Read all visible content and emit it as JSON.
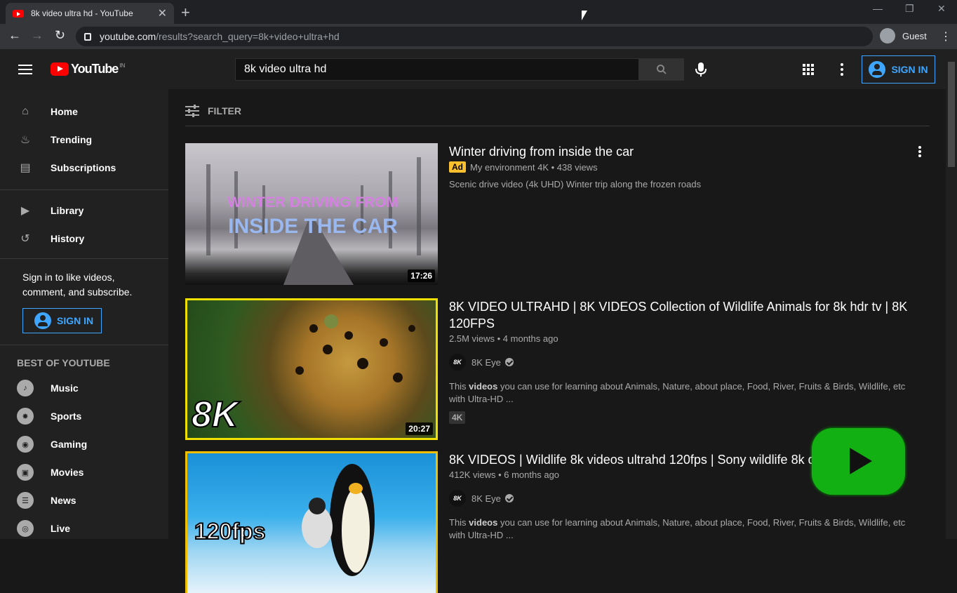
{
  "browser": {
    "tab_title": "8k video ultra hd - YouTube",
    "url_host": "youtube.com",
    "url_path": "/results?search_query=8k+video+ultra+hd",
    "profile": "Guest"
  },
  "header": {
    "logo_text": "YouTube",
    "country_code": "IN",
    "search_value": "8k video ultra hd",
    "sign_in": "SIGN IN"
  },
  "sidebar": {
    "items": [
      {
        "label": "Home",
        "icon": "home-icon"
      },
      {
        "label": "Trending",
        "icon": "flame-icon"
      },
      {
        "label": "Subscriptions",
        "icon": "subscriptions-icon"
      }
    ],
    "library_items": [
      {
        "label": "Library",
        "icon": "library-icon"
      },
      {
        "label": "History",
        "icon": "history-icon"
      }
    ],
    "signin_prompt": "Sign in to like videos, comment, and subscribe.",
    "signin_button": "SIGN IN",
    "best_heading": "BEST OF YOUTUBE",
    "best_items": [
      {
        "label": "Music",
        "icon": "music-icon"
      },
      {
        "label": "Sports",
        "icon": "sports-icon"
      },
      {
        "label": "Gaming",
        "icon": "gaming-icon"
      },
      {
        "label": "Movies",
        "icon": "movies-icon"
      },
      {
        "label": "News",
        "icon": "news-icon"
      },
      {
        "label": "Live",
        "icon": "live-icon"
      }
    ]
  },
  "main": {
    "filter_label": "FILTER",
    "results": [
      {
        "title": "Winter driving from inside the car",
        "ad_label": "Ad",
        "channel_meta": "My environment 4K • 438 views",
        "description": "Scenic drive video (4k UHD) Winter trip along the frozen roads",
        "duration": "17:26",
        "thumb_text_1": "WINTER DRIVING FROM",
        "thumb_text_2": "INSIDE THE CAR"
      },
      {
        "title": "8K VIDEO ULTRAHD | 8K VIDEOS Collection of Wildlife Animals for 8k hdr tv | 8K 120FPS",
        "meta": "2.5M views • 4 months ago",
        "channel": "8K Eye",
        "desc_pre": "This ",
        "desc_bold": "videos",
        "desc_post": " you can use for learning about Animals, Nature, about place, Food, River, Fruits & Birds, Wildlife, etc with Ultra-HD ...",
        "badge": "4K",
        "duration": "20:27",
        "thumb_text": "8K"
      },
      {
        "title": "8K VIDEOS | Wildlife 8k videos ultrahd 120fps | Sony wildlife 8k demo video",
        "meta": "412K views • 6 months ago",
        "channel": "8K Eye",
        "desc_pre": "This ",
        "desc_bold": "videos",
        "desc_post": " you can use for learning about Animals, Nature, about place, Food, River, Fruits & Birds, Wildlife, etc with Ultra-HD ...",
        "thumb_text": "120fps"
      }
    ]
  },
  "colors": {
    "accent": "#3ea6ff",
    "brand": "#ff0000",
    "ad": "#fbc02d",
    "thumb_border": "#f0e000"
  }
}
